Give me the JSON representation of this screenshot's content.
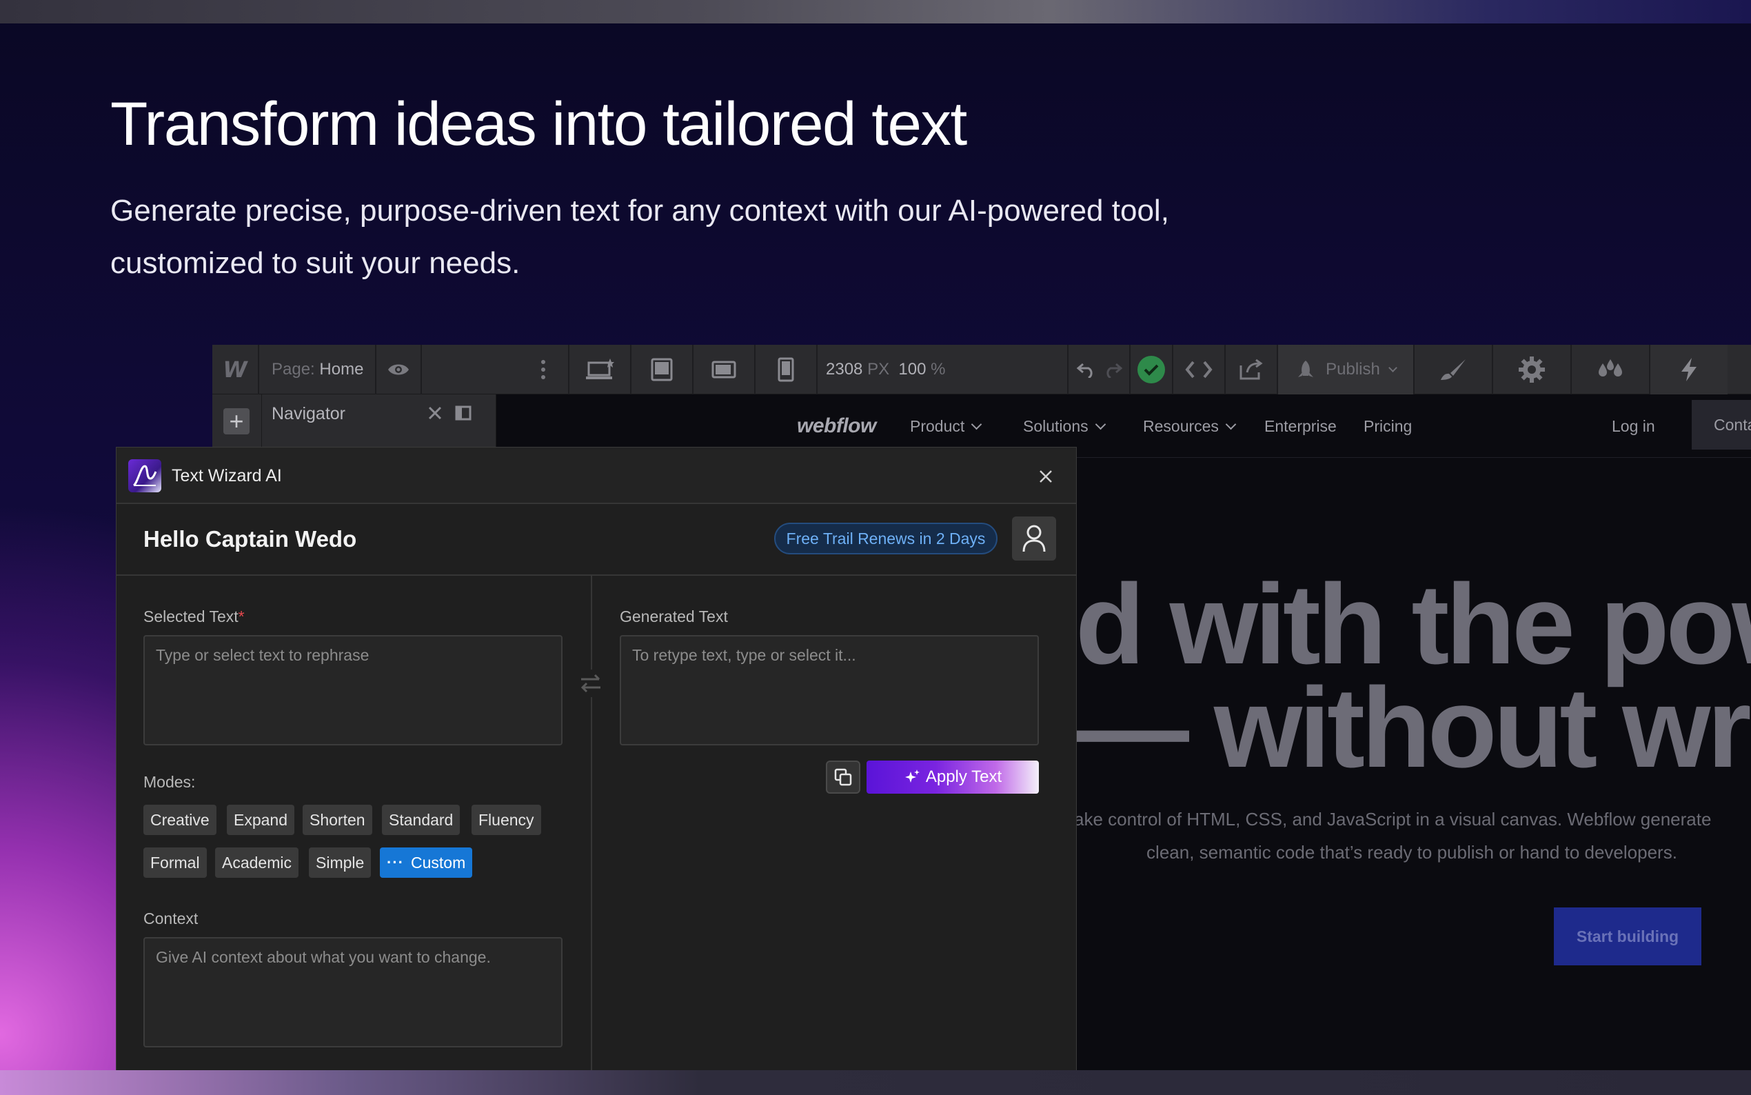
{
  "hero": {
    "title": "Transform ideas into tailored text",
    "subtitle": "Generate precise, purpose-driven text for any context with our AI-powered tool, customized to suit your needs."
  },
  "designer": {
    "page_label": "Page:",
    "page_name": "Home",
    "width_value": "2308",
    "width_unit": "PX",
    "zoom_value": "100",
    "zoom_unit": "%",
    "publish_label": "Publish",
    "navigator_title": "Navigator"
  },
  "site": {
    "logo": "webflow",
    "nav": [
      "Product",
      "Solutions",
      "Resources",
      "Enterprise",
      "Pricing"
    ],
    "login": "Log in",
    "contact": "Contact",
    "headline_line1": "d with the powe",
    "headline_line2": "— without writin",
    "para_line1": "ake control of HTML, CSS, and JavaScript in a visual canvas. Webflow generate",
    "para_line2": "clean, semantic code that’s ready to publish or hand to developers.",
    "cta": "Start building"
  },
  "wizard": {
    "title": "Text Wizard AI",
    "greeting": "Hello Captain Wedo",
    "trial_badge": "Free Trail Renews in 2 Days",
    "selected_label": "Selected Text",
    "required_mark": "*",
    "selected_placeholder": "Type or select text to rephrase",
    "generated_label": "Generated Text",
    "generated_placeholder": "To retype text, type or select it...",
    "modes_label": "Modes:",
    "modes": [
      "Creative",
      "Expand",
      "Shorten",
      "Standard",
      "Fluency",
      "Formal",
      "Academic",
      "Simple",
      "Custom"
    ],
    "active_mode": "Custom",
    "context_label": "Context",
    "context_placeholder": "Give AI context about what you want to change.",
    "apply_label": "Apply Text"
  },
  "colors": {
    "accent_blue": "#1677d6",
    "apply_gradient_start": "#5a14d8",
    "badge_text": "#6eb0f6",
    "required": "#e5484d"
  }
}
